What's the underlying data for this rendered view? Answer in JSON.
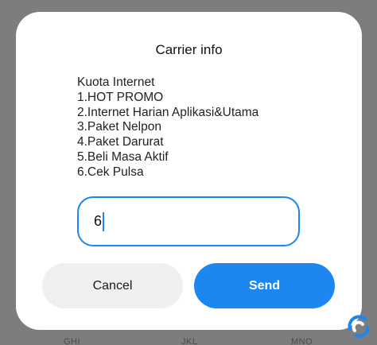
{
  "dialog": {
    "title": "Carrier info",
    "message_lines": [
      "Kuota Internet",
      "1.HOT PROMO",
      "2.Internet Harian Aplikasi&Utama",
      "3.Paket Nelpon",
      "4.Paket Darurat",
      "5.Beli Masa Aktif",
      "6.Cek Pulsa"
    ],
    "input_value": "6",
    "cancel_label": "Cancel",
    "send_label": "Send"
  },
  "background": {
    "keypad_labels": [
      "GHI",
      "JKL",
      "MNO"
    ]
  },
  "colors": {
    "accent": "#1c87f0",
    "dialog_bg": "#ffffff",
    "cancel_bg": "#efefef",
    "scrim": "#7d7d7d"
  },
  "icons": {
    "watermark": "brand-logo-icon"
  }
}
